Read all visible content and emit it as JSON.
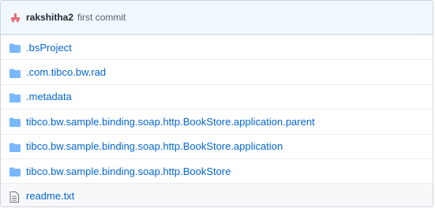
{
  "commit": {
    "author": "rakshitha2",
    "message": "first commit"
  },
  "entries": [
    {
      "name": ".bsProject",
      "type": "folder",
      "icon": "folder-icon"
    },
    {
      "name": ".com.tibco.bw.rad",
      "type": "folder",
      "icon": "folder-icon"
    },
    {
      "name": ".metadata",
      "type": "folder",
      "icon": "folder-icon"
    },
    {
      "name": "tibco.bw.sample.binding.soap.http.BookStore.application.parent",
      "type": "folder",
      "icon": "folder-icon"
    },
    {
      "name": "tibco.bw.sample.binding.soap.http.BookStore.application",
      "type": "folder",
      "icon": "folder-icon"
    },
    {
      "name": "tibco.bw.sample.binding.soap.http.BookStore",
      "type": "folder",
      "icon": "folder-icon"
    },
    {
      "name": "readme.txt",
      "type": "file",
      "icon": "file-text-icon"
    }
  ],
  "colors": {
    "link": "#0366d6",
    "folder_icon": "#79b8ff",
    "commit_bar_bg": "#f1f8ff"
  }
}
